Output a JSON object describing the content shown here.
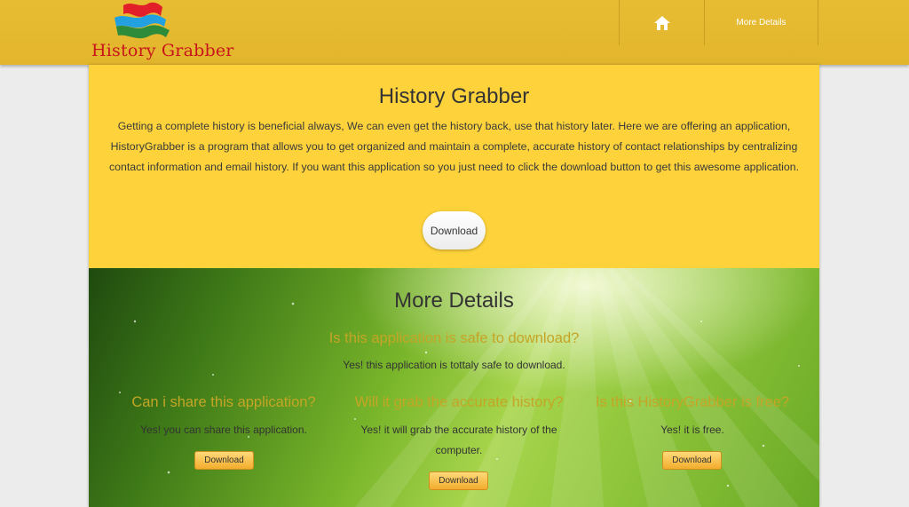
{
  "header": {
    "logo_text": "History Grabber",
    "nav": {
      "home_icon": "home-icon",
      "more_details_label": "More Details"
    }
  },
  "hero": {
    "title": "History Grabber",
    "description": "Getting a complete history is beneficial always, We can even get the history back, use that history later. Here we are offering an application, HistoryGrabber is a program that allows you to get organized and maintain a complete, accurate history of contact relationships by centralizing contact information and email history. If you want this application so you just need to click the download button to get this awesome application.",
    "download_label": "Download"
  },
  "details": {
    "title": "More Details",
    "faq_main": {
      "question": "Is this application is safe to download?",
      "answer": "Yes! this application is tottaly safe to download."
    },
    "faqs": [
      {
        "question": "Can i share this application?",
        "answer": "Yes! you can share this application.",
        "button": "Download"
      },
      {
        "question": "Will it grab the accurate history?",
        "answer": "Yes! it will grab the accurate history of the computer.",
        "button": "Download"
      },
      {
        "question": "Is this HistoryGrabber is free?",
        "answer": "Yes! it is free.",
        "button": "Download"
      }
    ]
  },
  "colors": {
    "header_bg": "#e4b82f",
    "hero_bg": "#fdd23a",
    "question_text": "#c5a526",
    "logo_text": "#c8151b"
  }
}
